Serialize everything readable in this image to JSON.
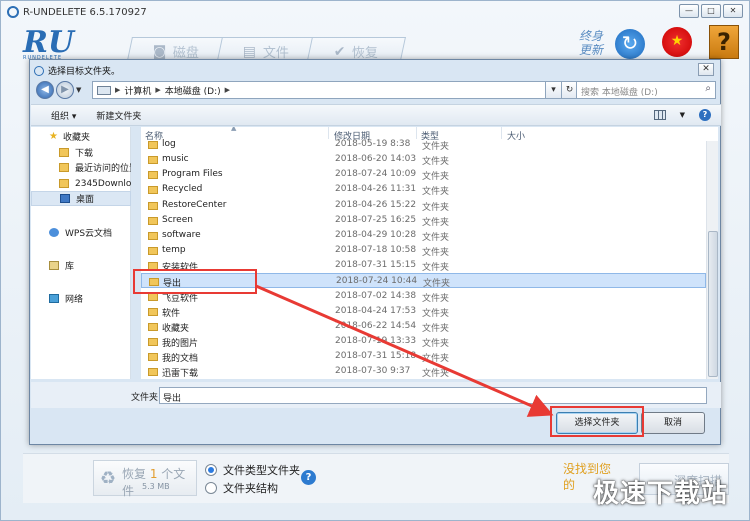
{
  "app": {
    "title": "R-UNDELETE 6.5.170927",
    "brand": "RU",
    "brand_sub": "RUNDELETE",
    "tabs": [
      {
        "label": "磁盘",
        "icon": "disk-icon"
      },
      {
        "label": "文件",
        "icon": "file-icon"
      },
      {
        "label": "恢复",
        "icon": "check-icon"
      }
    ],
    "update_line1": "终身",
    "update_line2": "更新",
    "window_buttons": [
      "—",
      "□",
      "✕"
    ]
  },
  "dialog": {
    "title": "选择目标文件夹。",
    "close": "✕",
    "address": {
      "crumbs": [
        "计算机",
        "本地磁盘 (D:)"
      ]
    },
    "search_placeholder": "搜索 本地磁盘 (D:)",
    "toolbar": {
      "organize": "组织 ▾",
      "new_folder": "新建文件夹"
    },
    "nav": {
      "favorites": "收藏夹",
      "downloads": "下载",
      "recent": "最近访问的位置",
      "folder_2345": "2345Downloa",
      "desktop": "桌面",
      "wps": "WPS云文档",
      "library": "库",
      "network": "网络"
    },
    "columns": {
      "name": "名称",
      "date": "修改日期",
      "type": "类型",
      "size": "大小"
    },
    "files": [
      {
        "name": "log",
        "date": "2018-05-19 8:38",
        "type": "文件夹"
      },
      {
        "name": "music",
        "date": "2018-06-20 14:03",
        "type": "文件夹"
      },
      {
        "name": "Program Files",
        "date": "2018-07-24 10:09",
        "type": "文件夹"
      },
      {
        "name": "Recycled",
        "date": "2018-04-26 11:31",
        "type": "文件夹"
      },
      {
        "name": "RestoreCenter",
        "date": "2018-04-26 15:22",
        "type": "文件夹"
      },
      {
        "name": "Screen",
        "date": "2018-07-25 16:25",
        "type": "文件夹"
      },
      {
        "name": "software",
        "date": "2018-04-29 10:28",
        "type": "文件夹"
      },
      {
        "name": "temp",
        "date": "2018-07-18 10:58",
        "type": "文件夹"
      },
      {
        "name": "安装软件",
        "date": "2018-07-31 15:15",
        "type": "文件夹"
      },
      {
        "name": "导出",
        "date": "2018-07-24 10:44",
        "type": "文件夹",
        "selected": true
      },
      {
        "name": "飞豆软件",
        "date": "2018-07-02 14:38",
        "type": "文件夹"
      },
      {
        "name": "软件",
        "date": "2018-04-24 17:53",
        "type": "文件夹"
      },
      {
        "name": "收藏夹",
        "date": "2018-06-22 14:54",
        "type": "文件夹"
      },
      {
        "name": "我的图片",
        "date": "2018-07-19 13:33",
        "type": "文件夹"
      },
      {
        "name": "我的文档",
        "date": "2018-07-31 15:18",
        "type": "文件夹"
      },
      {
        "name": "迅雷下载",
        "date": "2018-07-30 9:37",
        "type": "文件夹"
      }
    ],
    "filename_label": "文件夹:",
    "filename_value": "导出",
    "select_button": "选择文件夹",
    "cancel_button": "取消"
  },
  "bottom": {
    "restore_prefix": "恢复 ",
    "restore_count": "1",
    "restore_suffix": " 个文件",
    "restore_size": "5.3 MB",
    "radio_by_type": "文件类型文件夹",
    "radio_by_structure": "文件夹结构",
    "not_found_line1": "没找到您",
    "not_found_line2": "的",
    "deep_scan": "深度扫描",
    "watermark": "极速下载站"
  },
  "colors": {
    "accent": "#2a6db5",
    "annotation": "#e83a34",
    "selected_row": "#cfe3fb"
  }
}
